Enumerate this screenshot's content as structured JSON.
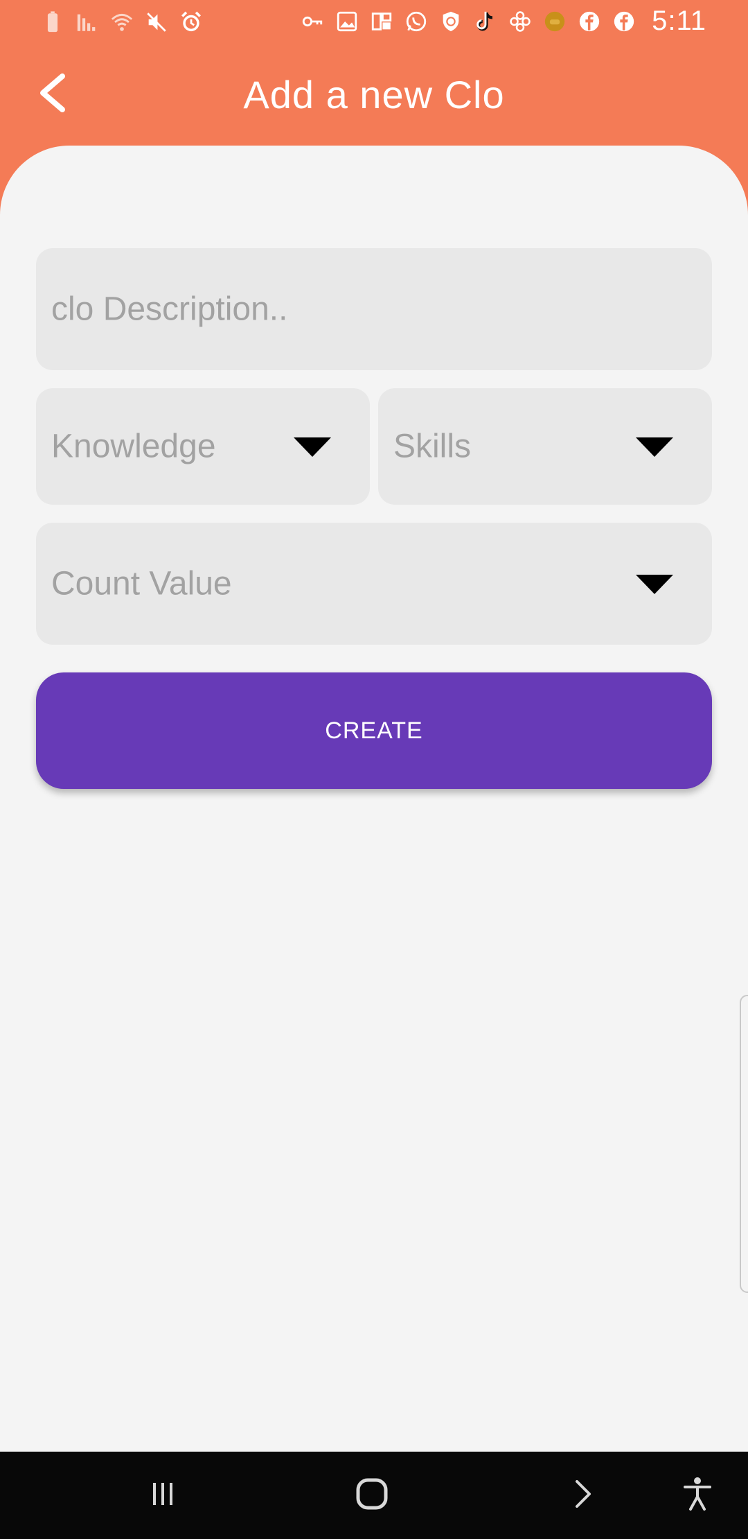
{
  "status_bar": {
    "time": "5:11",
    "left_icons": [
      "battery-icon",
      "signal-icon",
      "wifi-icon",
      "mute-icon",
      "alarm-icon"
    ],
    "right_icons": [
      "vpn-key-icon",
      "gallery-icon",
      "app-icon",
      "whatsapp-icon",
      "shield-icon",
      "tiktok-icon",
      "flower-icon",
      "game-icon",
      "facebook-icon",
      "facebook-icon"
    ]
  },
  "header": {
    "title": "Add a new Clo",
    "back_icon": "chevron-left-icon"
  },
  "form": {
    "description_placeholder": "clo Description..",
    "knowledge_placeholder": "Knowledge",
    "skills_placeholder": "Skills",
    "count_placeholder": "Count Value",
    "create_label": "CREATE"
  },
  "nav_bar": {
    "icons": [
      "recents-icon",
      "home-icon",
      "back-icon",
      "accessibility-icon"
    ]
  },
  "colors": {
    "header_bg": "#f47b56",
    "content_bg": "#f4f4f4",
    "field_bg": "#e8e8e8",
    "placeholder_text": "#a2a2a2",
    "button_bg": "#673ab7",
    "nav_bg": "#080808"
  }
}
